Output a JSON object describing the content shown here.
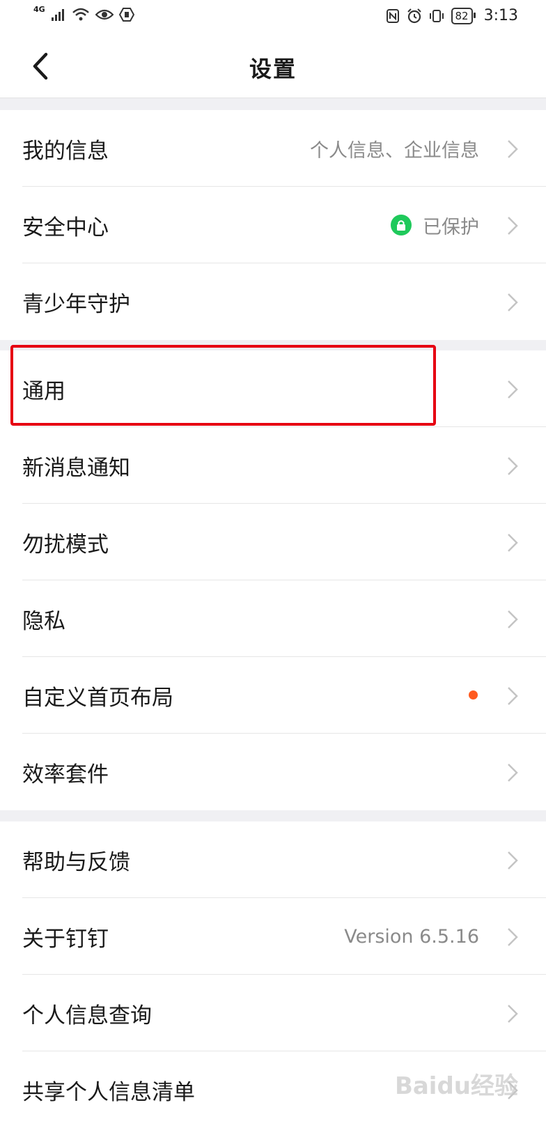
{
  "status_bar": {
    "network": "4G",
    "battery": "82",
    "time": "3:13",
    "icons": [
      "signal-icon",
      "wifi-icon",
      "eye-icon",
      "hand-icon",
      "nfc-icon",
      "alarm-icon",
      "vibrate-icon",
      "battery-icon"
    ]
  },
  "header": {
    "title": "设置",
    "back_icon": "chevron-left-icon"
  },
  "groups": [
    {
      "items": [
        {
          "label": "我的信息",
          "value": "个人信息、企业信息"
        },
        {
          "label": "安全中心",
          "value": "已保护",
          "badge_color": "#1fc95b"
        },
        {
          "label": "青少年守护",
          "value": ""
        }
      ]
    },
    {
      "items": [
        {
          "label": "通用",
          "value": "",
          "highlighted": true
        },
        {
          "label": "新消息通知",
          "value": ""
        },
        {
          "label": "勿扰模式",
          "value": ""
        },
        {
          "label": "隐私",
          "value": ""
        },
        {
          "label": "自定义首页布局",
          "value": "",
          "dot_color": "#ff5a1f"
        },
        {
          "label": "效率套件",
          "value": ""
        }
      ]
    },
    {
      "items": [
        {
          "label": "帮助与反馈",
          "value": ""
        },
        {
          "label": "关于钉钉",
          "value": "Version 6.5.16"
        },
        {
          "label": "个人信息查询",
          "value": ""
        },
        {
          "label": "共享个人信息清单",
          "value": ""
        }
      ]
    }
  ],
  "colors": {
    "highlight": "#e60012",
    "background_gap": "#f0f0f3",
    "secure_green": "#1fc95b",
    "notice_dot": "#ff5a1f"
  },
  "watermark": "Baidu经验"
}
